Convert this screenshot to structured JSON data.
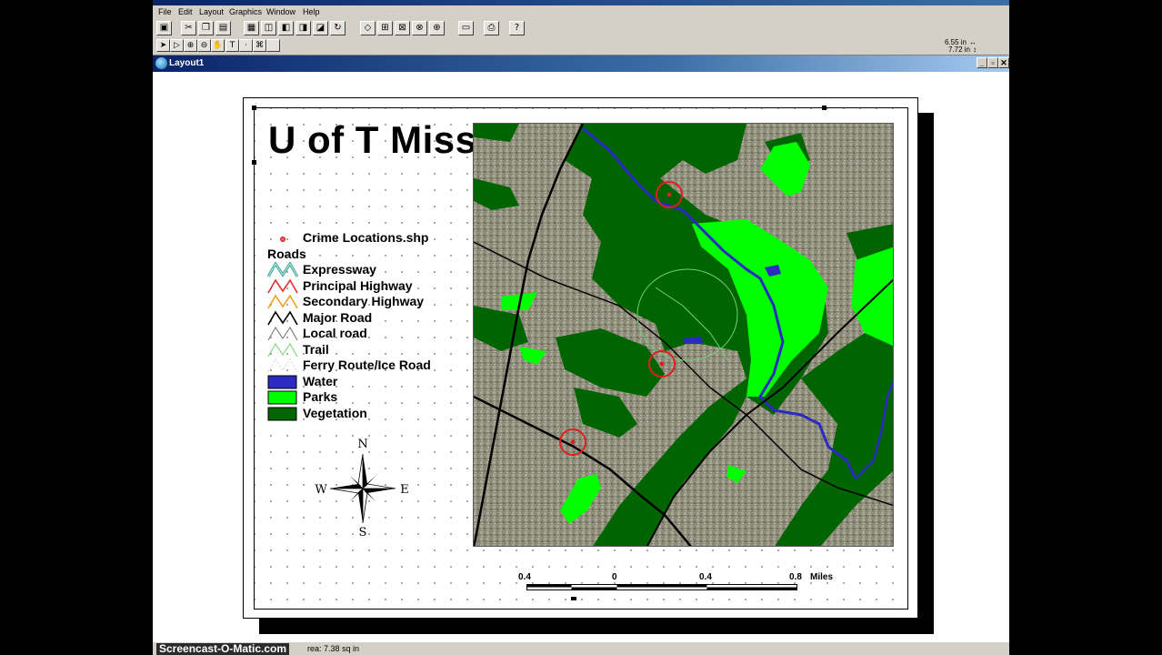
{
  "menu": {
    "items": [
      "File",
      "Edit",
      "Layout",
      "Graphics",
      "Window",
      "Help"
    ]
  },
  "toolbar": {
    "coords_line1": "6.55 in",
    "coords_line2": "7.72 in"
  },
  "document": {
    "title": "Layout1",
    "minimize": "_",
    "restore": "▫",
    "close": "✕"
  },
  "layout": {
    "title": "U of T Miss",
    "legend": {
      "crime_label": "Crime Locations.shp",
      "roads_header": "Roads",
      "roads": [
        {
          "label": "Expressway",
          "color": "#3aa79a"
        },
        {
          "label": "Principal Highway",
          "color": "#e03030"
        },
        {
          "label": "Secondary Highway",
          "color": "#f0a020"
        },
        {
          "label": "Major Road",
          "color": "#000000"
        },
        {
          "label": "Local road",
          "color": "#707070"
        },
        {
          "label": "Trail",
          "color": "#70d070"
        },
        {
          "label": "Ferry Route/Ice Road",
          "color": "#d0d0d0"
        }
      ],
      "polys": [
        {
          "label": "Water",
          "color": "#2b2bbf"
        },
        {
          "label": "Parks",
          "color": "#00ff00"
        },
        {
          "label": "Vegetation",
          "color": "#006400"
        }
      ]
    },
    "compass": {
      "n": "N",
      "s": "S",
      "e": "E",
      "w": "W"
    },
    "scale": {
      "labels": [
        "0.4",
        "0",
        "0.4",
        "0.8"
      ],
      "units": "Miles"
    }
  },
  "status": {
    "text": "rea: 7.38 sq in",
    "watermark": "Screencast-O-Matic.com"
  },
  "colors": {
    "titlebar": "#0a246a",
    "water": "#2b2bbf",
    "parks": "#00ff00",
    "vegetation": "#006400",
    "crime": "#e02020"
  }
}
